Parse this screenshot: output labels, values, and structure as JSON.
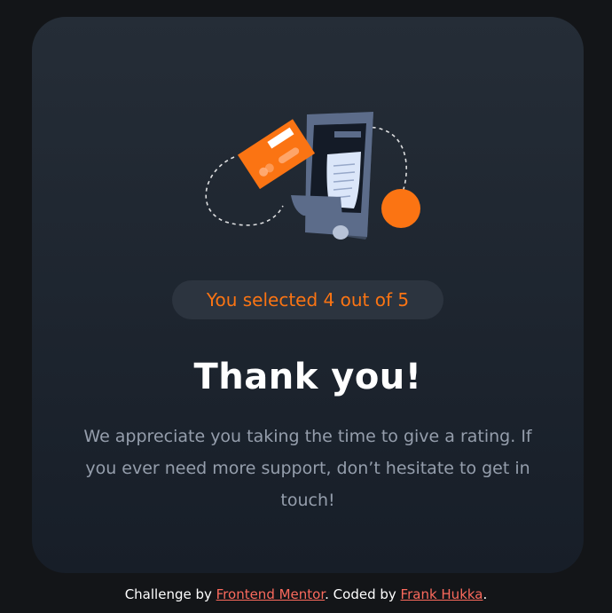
{
  "card": {
    "selected_text": "You selected 4 out of 5",
    "title": "Thank you!",
    "message": "We appreciate you taking the time to give a rating. If you ever need more support, don’t hesitate to get in touch!"
  },
  "illustration": {
    "icon": "phone-payment-illustration"
  },
  "attribution": {
    "prefix": "Challenge by ",
    "challenge_link": "Frontend Mentor",
    "middle": ". Coded by ",
    "author_link": "Frank Hukka",
    "suffix": "."
  },
  "colors": {
    "background": "#131518",
    "card_top": "#252d37",
    "card_bottom": "#171e28",
    "accent": "#fb7413",
    "link": "#fb6a5d",
    "muted_text": "#959eac"
  }
}
